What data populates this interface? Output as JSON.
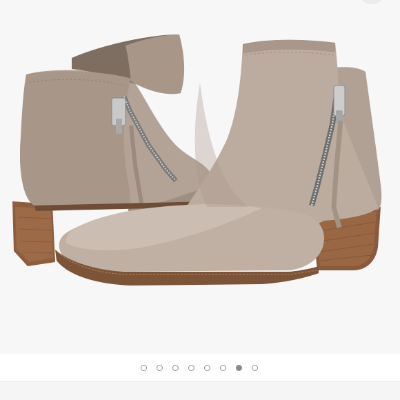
{
  "carousel": {
    "image_subject": "",
    "slide_count": 8,
    "active_index": 6
  },
  "colors": {
    "page_bg": "#f7f7f7",
    "leather": "#b8a89c",
    "leather_shadow": "#9a8a7e",
    "heel_wood": "#8a5a3c",
    "dot_inactive": "#8a8a8a",
    "dot_active": "#8a8a8a"
  }
}
